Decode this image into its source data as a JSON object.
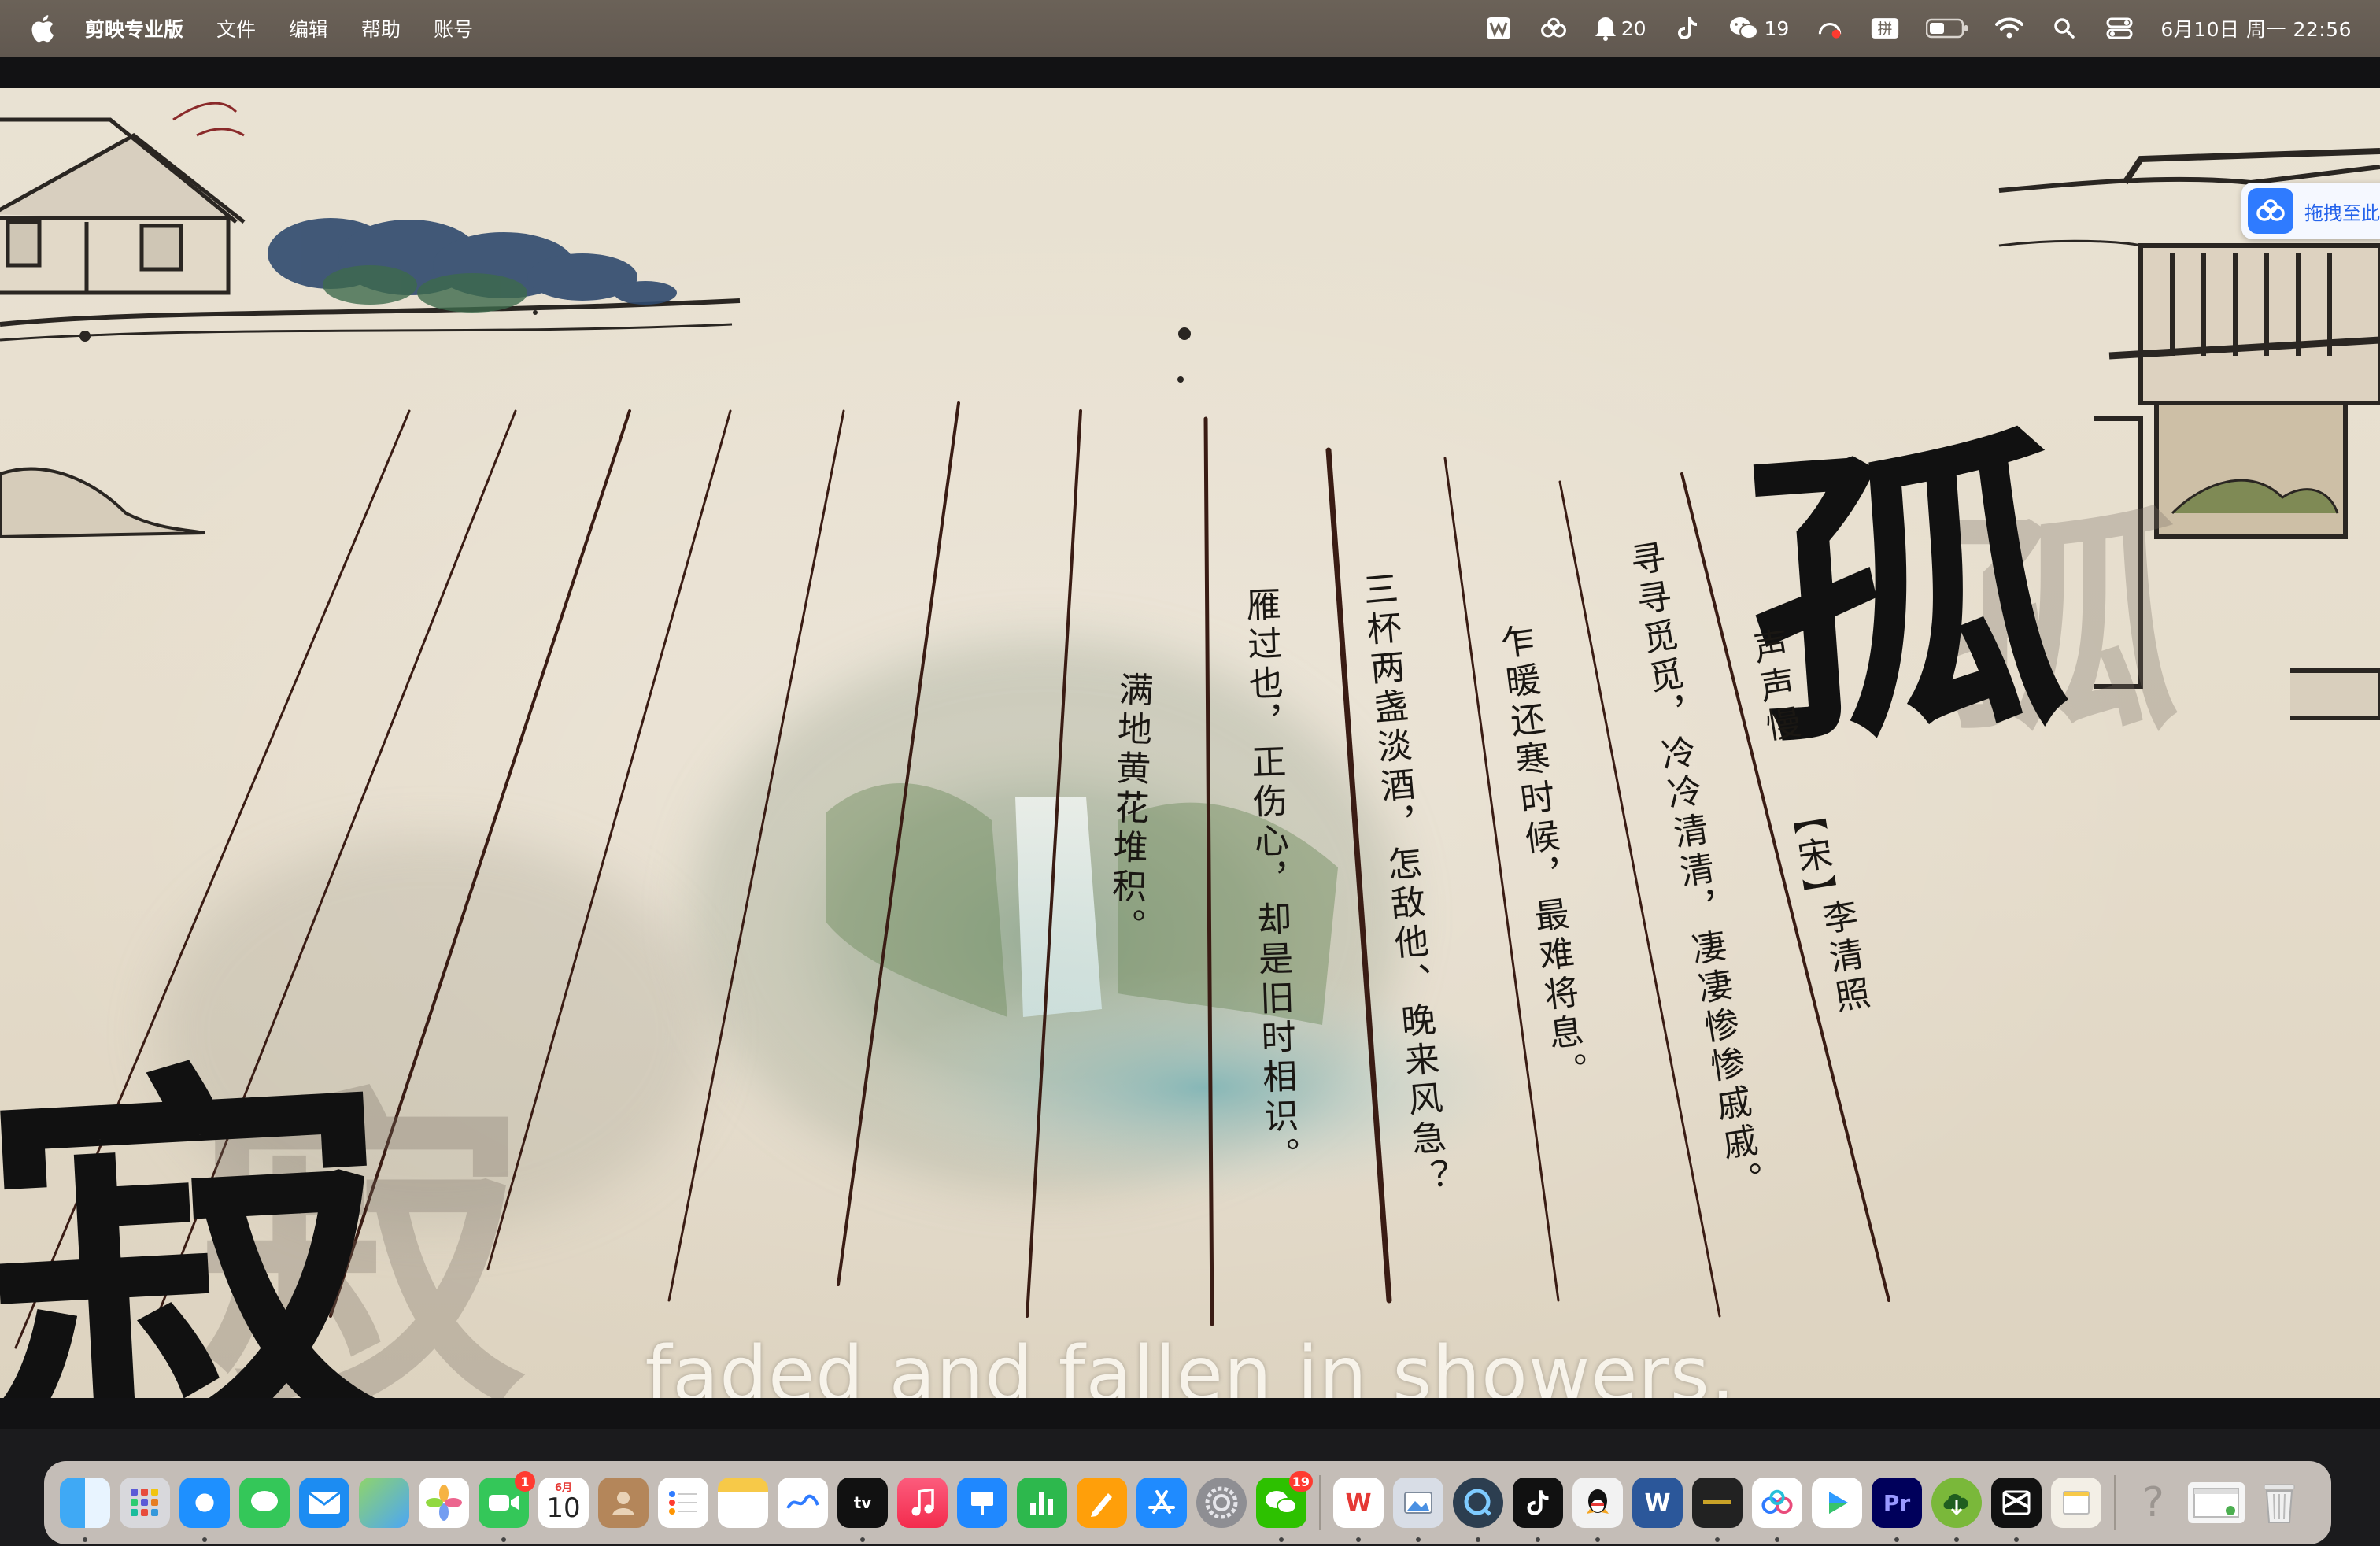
{
  "menubar": {
    "app_name": "剪映专业版",
    "menus": [
      "文件",
      "编辑",
      "帮助",
      "账号"
    ],
    "qq_count": "20",
    "wechat_count": "19",
    "clock": "6月10日 周一  22:56"
  },
  "baidu_chip": {
    "label": "拖拽至此"
  },
  "poem": {
    "title": "声声慢",
    "dynasty": "【宋】",
    "author": "李清照",
    "lines": [
      "寻寻觅觅，冷冷清清，凄凄惨惨戚戚。",
      "乍暖还寒时候，最难将息。",
      "三杯两盏淡酒，怎敌他、晚来风急？",
      "雁过也，正伤心，却是旧时相识。",
      "满地黄花堆积。"
    ],
    "big_char_right": "孤",
    "big_char_left": "寂"
  },
  "subtitle": "faded and fallen in showers,",
  "dock": {
    "calendar_month": "6月",
    "calendar_day": "10",
    "facetime_badge": "1",
    "wechat_badge": "19",
    "apps": [
      "Finder",
      "Launchpad",
      "Safari",
      "Messages",
      "Mail",
      "Maps",
      "Photos",
      "FaceTime",
      "Calendar",
      "Contacts",
      "Reminders",
      "Notes",
      "Freeform",
      "TV",
      "Music",
      "Keynote",
      "Numbers",
      "Pages",
      "App Store",
      "System Settings",
      "WeChat",
      "WPS",
      "Preview",
      "QuickTime",
      "TikTok",
      "QQ",
      "Word",
      "Terminal",
      "Baidu Netdisk",
      "Infuse",
      "Premiere Pro",
      "Downloader",
      "CapCut",
      "Stickies",
      "Help",
      "Screenshot",
      "Trash"
    ]
  }
}
